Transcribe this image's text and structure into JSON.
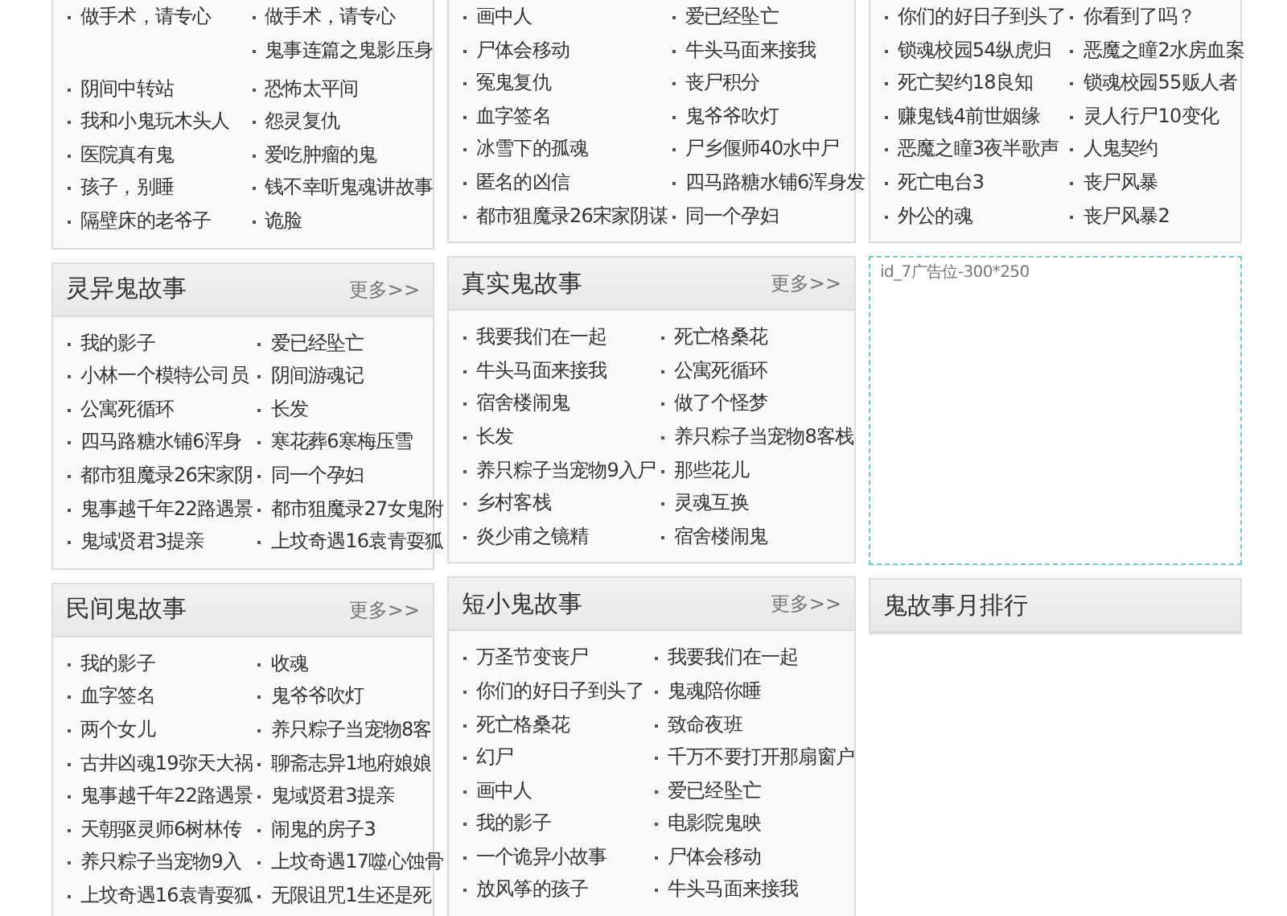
{
  "columns": [
    {
      "panels": [
        {
          "kind": "list",
          "items": [
            {
              "kind": "link",
              "title": "做手术，请专心"
            },
            {
              "kind": "link",
              "title": "做手术，请专心"
            },
            {
              "kind": "blank"
            },
            {
              "kind": "link",
              "title": "鬼事连篇之鬼影压身"
            },
            {
              "kind": "link",
              "title": "阴间中转站"
            },
            {
              "kind": "link",
              "title": "恐怖太平间"
            },
            {
              "kind": "link",
              "title": "我和小鬼玩木头人"
            },
            {
              "kind": "link",
              "title": "怨灵复仇"
            },
            {
              "kind": "link",
              "title": "医院真有鬼"
            },
            {
              "kind": "link",
              "title": "爱吃肿瘤的鬼"
            },
            {
              "kind": "link",
              "title": "孩子，别睡"
            },
            {
              "kind": "link",
              "title": "钱不幸听鬼魂讲故事"
            },
            {
              "kind": "link",
              "title": "隔壁床的老爷子"
            },
            {
              "kind": "link",
              "title": "诡脸"
            }
          ]
        },
        {
          "kind": "list",
          "title": "灵异鬼故事",
          "more": "更多>>",
          "items": [
            {
              "kind": "link",
              "title": "我的影子"
            },
            {
              "kind": "link",
              "title": "爱已经坠亡"
            },
            {
              "kind": "link",
              "title": "小林一个模特公司员"
            },
            {
              "kind": "link",
              "title": "阴间游魂记"
            },
            {
              "kind": "link",
              "title": "公寓死循环"
            },
            {
              "kind": "link",
              "title": "长发"
            },
            {
              "kind": "link",
              "title": "四马路糖水铺6浑身"
            },
            {
              "kind": "link",
              "title": "寒花葬6寒梅压雪"
            },
            {
              "kind": "link",
              "title": "都市狙魔录26宋家阴"
            },
            {
              "kind": "link",
              "title": "同一个孕妇"
            },
            {
              "kind": "link",
              "title": "鬼事越千年22路遇景"
            },
            {
              "kind": "link",
              "title": "都市狙魔录27女鬼附"
            },
            {
              "kind": "link",
              "title": "鬼域贤君3提亲"
            },
            {
              "kind": "link",
              "title": "上坟奇遇16袁青耍狐"
            }
          ]
        },
        {
          "kind": "list",
          "title": "民间鬼故事",
          "more": "更多>>",
          "items": [
            {
              "kind": "link",
              "title": "我的影子"
            },
            {
              "kind": "link",
              "title": "收魂"
            },
            {
              "kind": "link",
              "title": "血字签名"
            },
            {
              "kind": "link",
              "title": "鬼爷爷吹灯"
            },
            {
              "kind": "link",
              "title": "两个女儿"
            },
            {
              "kind": "link",
              "title": "养只粽子当宠物8客"
            },
            {
              "kind": "link",
              "title": "古井凶魂19弥天大祸"
            },
            {
              "kind": "link",
              "title": "聊斋志异1地府娘娘"
            },
            {
              "kind": "link",
              "title": "鬼事越千年22路遇景"
            },
            {
              "kind": "link",
              "title": "鬼域贤君3提亲"
            },
            {
              "kind": "link",
              "title": "天朝驱灵师6树林传"
            },
            {
              "kind": "link",
              "title": "闹鬼的房子3"
            },
            {
              "kind": "link",
              "title": "养只粽子当宠物9入"
            },
            {
              "kind": "link",
              "title": "上坟奇遇17噬心蚀骨"
            },
            {
              "kind": "link",
              "title": "上坟奇遇16袁青耍狐"
            },
            {
              "kind": "link",
              "title": "无限诅咒1生还是死"
            }
          ]
        }
      ]
    },
    {
      "panels": [
        {
          "kind": "list",
          "items": [
            {
              "kind": "link",
              "title": "画中人"
            },
            {
              "kind": "link",
              "title": "爱已经坠亡"
            },
            {
              "kind": "link",
              "title": "尸体会移动"
            },
            {
              "kind": "link",
              "title": "牛头马面来接我"
            },
            {
              "kind": "link",
              "title": "冤鬼复仇"
            },
            {
              "kind": "link",
              "title": "丧尸积分"
            },
            {
              "kind": "link",
              "title": "血字签名"
            },
            {
              "kind": "link",
              "title": "鬼爷爷吹灯"
            },
            {
              "kind": "link",
              "title": "冰雪下的孤魂"
            },
            {
              "kind": "link",
              "title": "尸乡偃师40水中尸"
            },
            {
              "kind": "link",
              "title": "匿名的凶信"
            },
            {
              "kind": "link",
              "title": "四马路糖水铺6浑身发"
            },
            {
              "kind": "link",
              "title": "都市狙魔录26宋家阴谋"
            },
            {
              "kind": "link",
              "title": "同一个孕妇"
            }
          ]
        },
        {
          "kind": "list",
          "title": "真实鬼故事",
          "more": "更多>>",
          "items": [
            {
              "kind": "link",
              "title": "我要我们在一起"
            },
            {
              "kind": "link",
              "title": "死亡格桑花"
            },
            {
              "kind": "link",
              "title": "牛头马面来接我"
            },
            {
              "kind": "link",
              "title": "公寓死循环"
            },
            {
              "kind": "link",
              "title": "宿舍楼闹鬼"
            },
            {
              "kind": "link",
              "title": "做了个怪梦"
            },
            {
              "kind": "link",
              "title": "长发"
            },
            {
              "kind": "link",
              "title": "养只粽子当宠物8客栈"
            },
            {
              "kind": "link",
              "title": "养只粽子当宠物9入尸"
            },
            {
              "kind": "link",
              "title": "那些花儿"
            },
            {
              "kind": "link",
              "title": "乡村客栈"
            },
            {
              "kind": "link",
              "title": "灵魂互换"
            },
            {
              "kind": "link",
              "title": "炎少甫之镜精"
            },
            {
              "kind": "link",
              "title": "宿舍楼闹鬼"
            }
          ]
        },
        {
          "kind": "list",
          "title": "短小鬼故事",
          "more": "更多>>",
          "items": [
            {
              "kind": "link",
              "title": "万圣节变丧尸"
            },
            {
              "kind": "link",
              "title": "我要我们在一起"
            },
            {
              "kind": "link",
              "title": "你们的好日子到头了"
            },
            {
              "kind": "link",
              "title": "鬼魂陪你睡"
            },
            {
              "kind": "link",
              "title": "死亡格桑花"
            },
            {
              "kind": "link",
              "title": "致命夜班"
            },
            {
              "kind": "link",
              "title": "幻尸"
            },
            {
              "kind": "link",
              "title": "千万不要打开那扇窗户"
            },
            {
              "kind": "link",
              "title": "画中人"
            },
            {
              "kind": "link",
              "title": "爱已经坠亡"
            },
            {
              "kind": "link",
              "title": "我的影子"
            },
            {
              "kind": "link",
              "title": "电影院鬼映"
            },
            {
              "kind": "link",
              "title": "一个诡异小故事"
            },
            {
              "kind": "link",
              "title": "尸体会移动"
            },
            {
              "kind": "link",
              "title": "放风筝的孩子"
            },
            {
              "kind": "link",
              "title": "牛头马面来接我"
            }
          ]
        }
      ]
    },
    {
      "panels": [
        {
          "kind": "list",
          "items": [
            {
              "kind": "link",
              "title": "你们的好日子到头了"
            },
            {
              "kind": "link",
              "title": "你看到了吗？"
            },
            {
              "kind": "link",
              "title": "锁魂校园54纵虎归"
            },
            {
              "kind": "link",
              "title": "恶魔之瞳2水房血案"
            },
            {
              "kind": "link",
              "title": "死亡契约18良知"
            },
            {
              "kind": "link",
              "title": "锁魂校园55贩人者"
            },
            {
              "kind": "link",
              "title": "赚鬼钱4前世姻缘"
            },
            {
              "kind": "link",
              "title": "灵人行尸10变化"
            },
            {
              "kind": "link",
              "title": "恶魔之瞳3夜半歌声"
            },
            {
              "kind": "link",
              "title": "人鬼契约"
            },
            {
              "kind": "link",
              "title": "死亡电台3"
            },
            {
              "kind": "link",
              "title": "丧尸风暴"
            },
            {
              "kind": "link",
              "title": "外公的魂"
            },
            {
              "kind": "link",
              "title": "丧尸风暴2"
            }
          ]
        },
        {
          "kind": "ad",
          "text": "id_7广告位-300*250"
        },
        {
          "kind": "list",
          "title": "鬼故事月排行"
        }
      ]
    }
  ]
}
